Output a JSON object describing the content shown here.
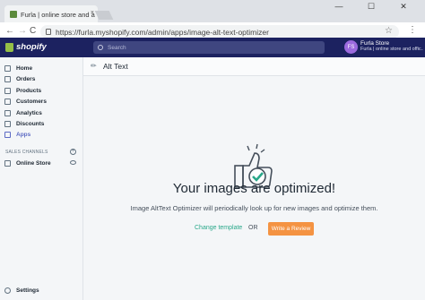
{
  "browser": {
    "tab_title": "Furla | online store and a",
    "tab_close": "×",
    "url": "https://furla.myshopify.com/admin/apps/image-alt-text-optimizer",
    "back": "←",
    "forward": "→",
    "reload": "C",
    "star": "☆",
    "menu": "⋮",
    "minimize": "—",
    "maximize": "☐",
    "close": "✕"
  },
  "topbar": {
    "logo_text": "shopify",
    "search_placeholder": "Search",
    "avatar_initials": "FS",
    "store_name": "Furla Store",
    "store_subtitle": "Furla | online store and offic..."
  },
  "sidebar": {
    "items": [
      {
        "label": "Home",
        "icon": "home-icon"
      },
      {
        "label": "Orders",
        "icon": "orders-icon"
      },
      {
        "label": "Products",
        "icon": "products-icon"
      },
      {
        "label": "Customers",
        "icon": "customers-icon"
      },
      {
        "label": "Analytics",
        "icon": "analytics-icon"
      },
      {
        "label": "Discounts",
        "icon": "discounts-icon"
      },
      {
        "label": "Apps",
        "icon": "apps-icon"
      }
    ],
    "sales_channels_heading": "SALES CHANNELS",
    "online_store": "Online Store",
    "settings": "Settings"
  },
  "page": {
    "title": "Alt Text",
    "headline": "Your images are optimized!",
    "subtext": "Image AltText Optimizer will periodically look up for new images and optimize them.",
    "change_template": "Change template",
    "or": "OR",
    "review_button": "Write a Review"
  },
  "colors": {
    "topbar": "#1c2260",
    "accent_green": "#2aa88a",
    "review_orange": "#f49342",
    "apps_active": "#5c6ac4"
  }
}
